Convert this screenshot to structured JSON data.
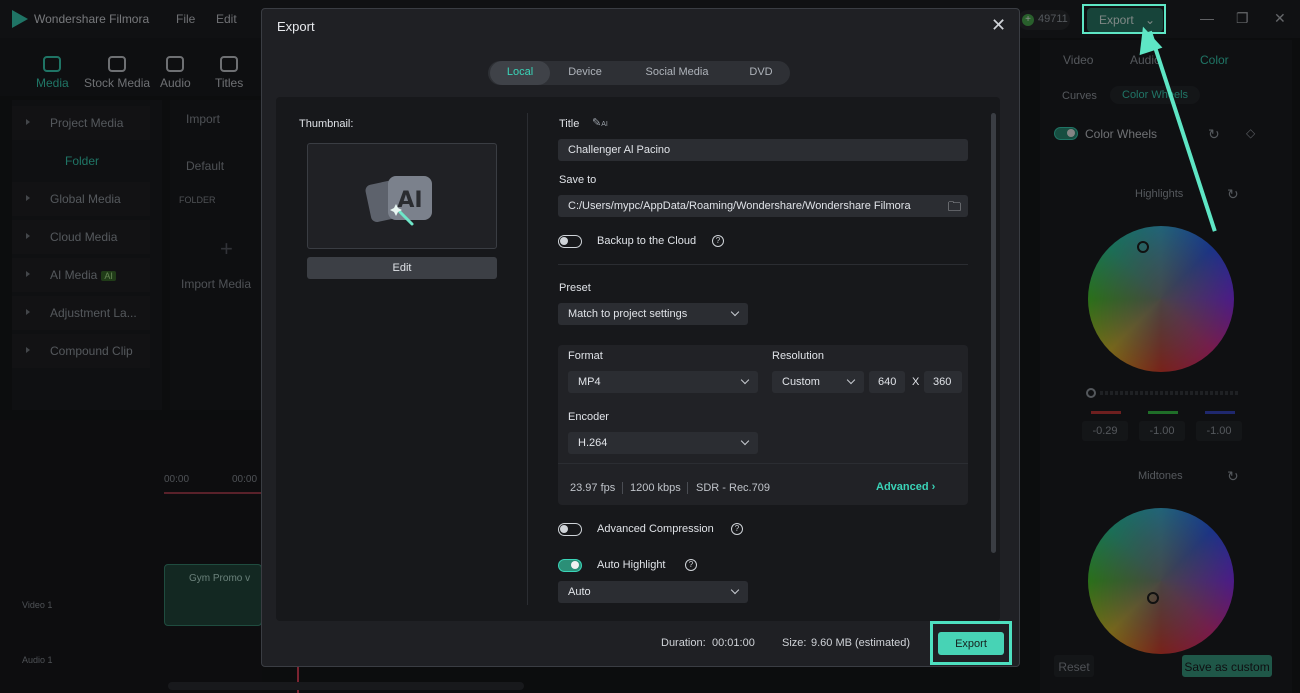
{
  "app": {
    "name": "Wondershare Filmora",
    "menu": [
      "File",
      "Edit"
    ],
    "coins": "49711",
    "top_export_label": "Export"
  },
  "toolbar": {
    "tools": [
      "Media",
      "Stock Media",
      "Audio",
      "Titles"
    ],
    "active": "Media"
  },
  "sidebar": {
    "items": [
      "Project Media",
      "Folder",
      "Global Media",
      "Cloud Media",
      "AI Media",
      "Adjustment La...",
      "Compound Clip"
    ],
    "ai_badge": "AI"
  },
  "media": {
    "import_label": "Import",
    "default_label": "Default",
    "folder_header": "FOLDER",
    "import_media_label": "Import Media"
  },
  "timeline": {
    "ruler": [
      "00:00",
      "00:00"
    ],
    "video_track": "Video 1",
    "audio_track": "Audio 1",
    "clip_name": "Gym Promo v"
  },
  "right_panel": {
    "tabs": [
      "Video",
      "Audio",
      "Color"
    ],
    "active_tab": "Color",
    "subtabs": [
      "Curves",
      "Color Wheels"
    ],
    "subtab_active": "Color Wheels",
    "color_wheels_label": "Color Wheels",
    "highlights_label": "Highlights",
    "highlight_values": [
      "-0.29",
      "-1.00",
      "-1.00"
    ],
    "midtones_label": "Midtones",
    "reset_label": "Reset",
    "save_custom_label": "Save as custom"
  },
  "export_dialog": {
    "title": "Export",
    "tabs": [
      "Local",
      "Device",
      "Social Media",
      "DVD"
    ],
    "active_tab": "Local",
    "thumbnail_label": "Thumbnail:",
    "edit_label": "Edit",
    "title_label": "Title",
    "title_value": "Challenger Al Pacino",
    "save_to_label": "Save to",
    "save_to_value": "C:/Users/mypc/AppData/Roaming/Wondershare/Wondershare Filmora",
    "backup_label": "Backup to the Cloud",
    "backup_on": false,
    "preset_label": "Preset",
    "preset_value": "Match to project settings",
    "format_label": "Format",
    "format_value": "MP4",
    "resolution_label": "Resolution",
    "resolution_value": "Custom",
    "res_width": "640",
    "res_x": "X",
    "res_height": "360",
    "encoder_label": "Encoder",
    "encoder_value": "H.264",
    "fps": "23.97 fps",
    "bitrate": "1200 kbps",
    "color_space": "SDR - Rec.709",
    "advanced_label": "Advanced",
    "adv_compression_label": "Advanced Compression",
    "adv_compression_on": false,
    "auto_highlight_label": "Auto Highlight",
    "auto_highlight_on": true,
    "auto_highlight_value": "Auto",
    "duration_label": "Duration:",
    "duration_value": "00:01:00",
    "size_label": "Size:",
    "size_value": "9.60 MB (estimated)",
    "export_label": "Export"
  },
  "colors": {
    "accent": "#3ad4b8",
    "annotation": "#5ee6c5"
  }
}
